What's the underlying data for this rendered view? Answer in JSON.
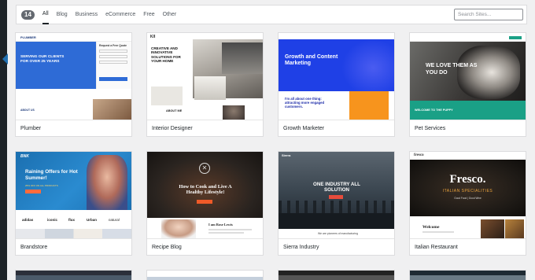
{
  "filter_bar": {
    "count": "14",
    "tabs": [
      "All",
      "Blog",
      "Business",
      "eCommerce",
      "Free",
      "Other"
    ],
    "active_tab": "All",
    "search_placeholder": "Search Sites..."
  },
  "templates": [
    {
      "name": "Plumber",
      "preview_logo": "PLUMBER",
      "preview_headline": "SERVING OUR CLIENTS FOR OVER 25 YEARS",
      "preview_form_title": "Request a Free Quote",
      "preview_section": "ABOUT US"
    },
    {
      "name": "Interior Designer",
      "preview_logo": "K/I",
      "preview_headline": "CREATIVE AND INNOVATIVE SOLUTIONS FOR YOUR HOME",
      "preview_section": "ABOUT ME"
    },
    {
      "name": "Growth Marketer",
      "preview_headline": "Growth and Content Marketing",
      "preview_tagline": "I'm all about one thing: attracting more engaged customers."
    },
    {
      "name": "Pet Services",
      "preview_headline": "WE LOVE THEM AS YOU DO",
      "preview_banner": "WELCOME TO THE PUPPY"
    },
    {
      "name": "Brandstore",
      "preview_logo": "BNK",
      "preview_headline": "Raining Offers for Hot Summer!",
      "preview_sub": "25% OFF ON ALL PRODUCTS",
      "preview_brands": [
        "adidas",
        "iconic",
        "flux",
        "Urban",
        "natural"
      ]
    },
    {
      "name": "Recipe Blog",
      "preview_headline": "How to Cook and Live A Healthy Lifestyle!",
      "preview_sub": "I am Rose Lewis"
    },
    {
      "name": "Sierra Industry",
      "preview_logo": "Sierra",
      "preview_headline": "ONE INDUSTRY ALL SOLUTION",
      "preview_sub": "We are pioneers of manufacturing"
    },
    {
      "name": "Italian Restaurant",
      "preview_logo": "fresco",
      "preview_headline": "Fresco.",
      "preview_sub": "ITALIAN SPECIALITIES",
      "preview_tag": "Good Food | Good Wine",
      "preview_section": "Welcome"
    }
  ],
  "colors": {
    "badge": "#646970",
    "plumber_blue": "#2e6bd6",
    "growth_blue": "#1f40e6",
    "growth_orange": "#f7941d",
    "pet_teal": "#1aa086",
    "brand_blue": "#1b6fb0",
    "recipe_dark": "#2a2420",
    "recipe_orange": "#f05a28",
    "sierra_dark": "#2f3a45",
    "fresco_dark": "#1e1a16",
    "fresco_gold": "#e9a23b"
  }
}
